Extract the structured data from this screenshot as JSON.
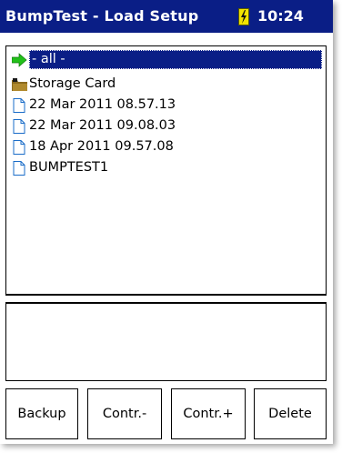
{
  "titlebar": {
    "title": "BumpTest - Load Setup",
    "time": "10:24",
    "battery_icon": "battery-charging-icon"
  },
  "file_list": {
    "items": [
      {
        "label": "- all -",
        "icon": "green-arrow-icon",
        "selected": true
      },
      {
        "label": "Storage Card",
        "icon": "storage-card-folder-icon",
        "selected": false
      },
      {
        "label": "22 Mar 2011 08.57.13",
        "icon": "file-icon",
        "selected": false
      },
      {
        "label": "22 Mar 2011 09.08.03",
        "icon": "file-icon",
        "selected": false
      },
      {
        "label": "18 Apr 2011 09.57.08",
        "icon": "file-icon",
        "selected": false
      },
      {
        "label": "BUMPTEST1",
        "icon": "file-icon",
        "selected": false
      }
    ]
  },
  "info_pane": {
    "text": ""
  },
  "buttons": {
    "backup": "Backup",
    "contrast_minus": "Contr.-",
    "contrast_plus": "Contr.+",
    "delete": "Delete"
  },
  "colors": {
    "titlebar_bg": "#0a1e86",
    "selection_bg": "#0a1e86",
    "battery": "#f2e300",
    "arrow": "#22c01a",
    "folder": "#8a6a1e"
  }
}
